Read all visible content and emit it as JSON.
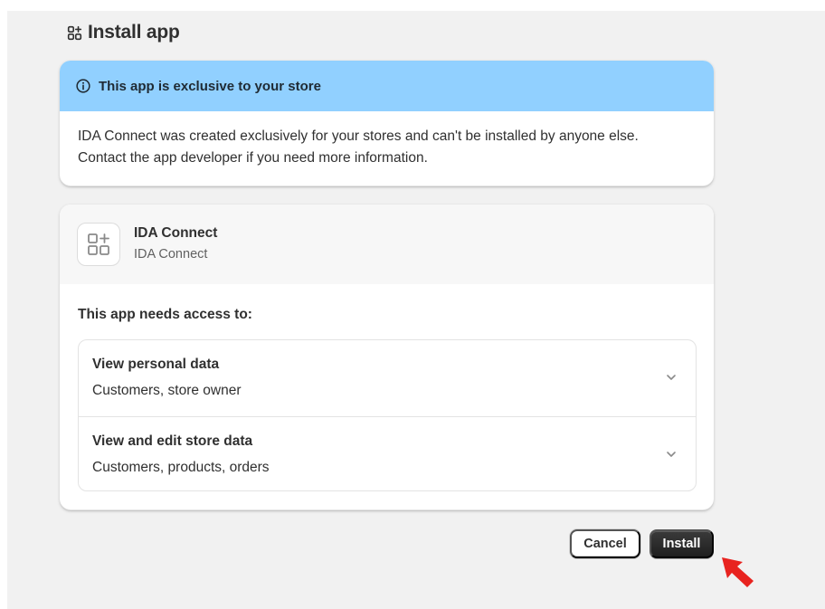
{
  "page": {
    "title": "Install app",
    "title_icon": "apps-icon"
  },
  "banner": {
    "icon": "info-icon",
    "title": "This app is exclusive to your store",
    "body": "IDA Connect was created exclusively for your stores and can't be installed by anyone else. Contact the app developer if you need more information.",
    "color": "#91d0ff"
  },
  "app": {
    "logo_icon": "app-placeholder-icon",
    "name": "IDA Connect",
    "developer": "IDA Connect"
  },
  "access": {
    "title": "This app needs access to:",
    "items": [
      {
        "title": "View personal data",
        "subtitle": "Customers, store owner"
      },
      {
        "title": "View and edit store data",
        "subtitle": "Customers, products, orders"
      }
    ]
  },
  "actions": {
    "cancel_label": "Cancel",
    "install_label": "Install",
    "install_color": "#303030"
  },
  "annotation": {
    "icon": "red-pointer-arrow",
    "color": "#e8231f"
  }
}
